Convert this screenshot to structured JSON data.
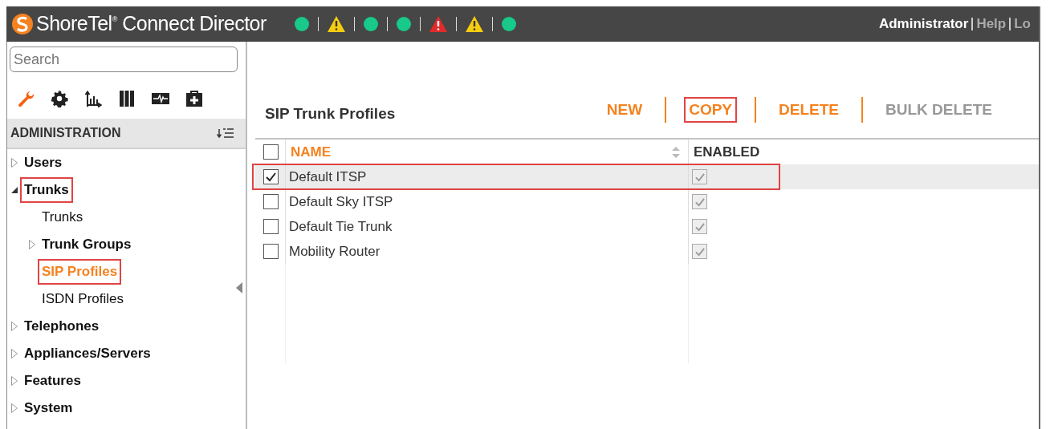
{
  "header": {
    "title": "ShoreTel$^{®}$ Connect Director",
    "status": [
      {
        "kind": "ok"
      },
      {
        "kind": "warning"
      },
      {
        "kind": "ok"
      },
      {
        "kind": "ok"
      },
      {
        "kind": "error"
      },
      {
        "kind": "warning"
      },
      {
        "kind": "ok"
      }
    ],
    "links": [
      {
        "label": "Administrator",
        "kind": "user"
      },
      {
        "label": "Help",
        "kind": "link"
      },
      {
        "label": "Lo",
        "kind": "link"
      }
    ]
  },
  "sidebar": {
    "search": {
      "placeholder": "Search"
    },
    "tools": [
      {
        "kind": "wrench",
        "selected": true
      },
      {
        "kind": "gear",
        "selected": false
      },
      {
        "kind": "chart",
        "selected": false
      },
      {
        "kind": "books",
        "selected": false
      },
      {
        "kind": "monitor",
        "selected": false
      },
      {
        "kind": "medkit",
        "selected": false
      }
    ],
    "section": "ADMINISTRATION",
    "tree": [
      {
        "label": "Users",
        "expanded": false,
        "selected": false,
        "highlighted": false
      },
      {
        "label": "Trunks",
        "expanded": true,
        "selected": false,
        "highlighted": true,
        "children": [
          {
            "label": "Trunks",
            "selected": false,
            "highlighted": false
          },
          {
            "label": "Trunk Groups",
            "expanded": false,
            "selected": false,
            "highlighted": false
          },
          {
            "label": "SIP Profiles",
            "selected": true,
            "highlighted": true
          },
          {
            "label": "ISDN Profiles",
            "selected": false,
            "highlighted": false
          }
        ]
      },
      {
        "label": "Telephones",
        "expanded": false,
        "selected": false,
        "highlighted": false
      },
      {
        "label": "Appliances/Servers",
        "expanded": false,
        "selected": false,
        "highlighted": false
      },
      {
        "label": "Features",
        "expanded": false,
        "selected": false,
        "highlighted": false
      },
      {
        "label": "System",
        "expanded": false,
        "selected": false,
        "highlighted": false
      }
    ]
  },
  "main": {
    "title": "SIP Trunk Profiles",
    "actions": [
      {
        "label": "NEW",
        "disabled": false,
        "highlighted": false
      },
      {
        "label": "COPY",
        "disabled": false,
        "highlighted": true
      },
      {
        "label": "DELETE",
        "disabled": false,
        "highlighted": false
      },
      {
        "label": "BULK DELETE",
        "disabled": true,
        "highlighted": false
      }
    ],
    "table": {
      "select_all": {
        "checked": false
      },
      "columns": [
        {
          "label": "NAME",
          "selected": true
        },
        {
          "label": "ENABLED",
          "selected": false
        }
      ],
      "rows": [
        {
          "name": "Default ITSP",
          "checked": true,
          "enabled": true,
          "selected": true,
          "highlighted": true
        },
        {
          "name": "Default Sky ITSP",
          "checked": false,
          "enabled": true,
          "selected": false,
          "highlighted": false
        },
        {
          "name": "Default Tie Trunk",
          "checked": false,
          "enabled": true,
          "selected": false,
          "highlighted": false
        },
        {
          "name": "Mobility Router",
          "checked": false,
          "enabled": true,
          "selected": false,
          "highlighted": false
        }
      ]
    }
  }
}
